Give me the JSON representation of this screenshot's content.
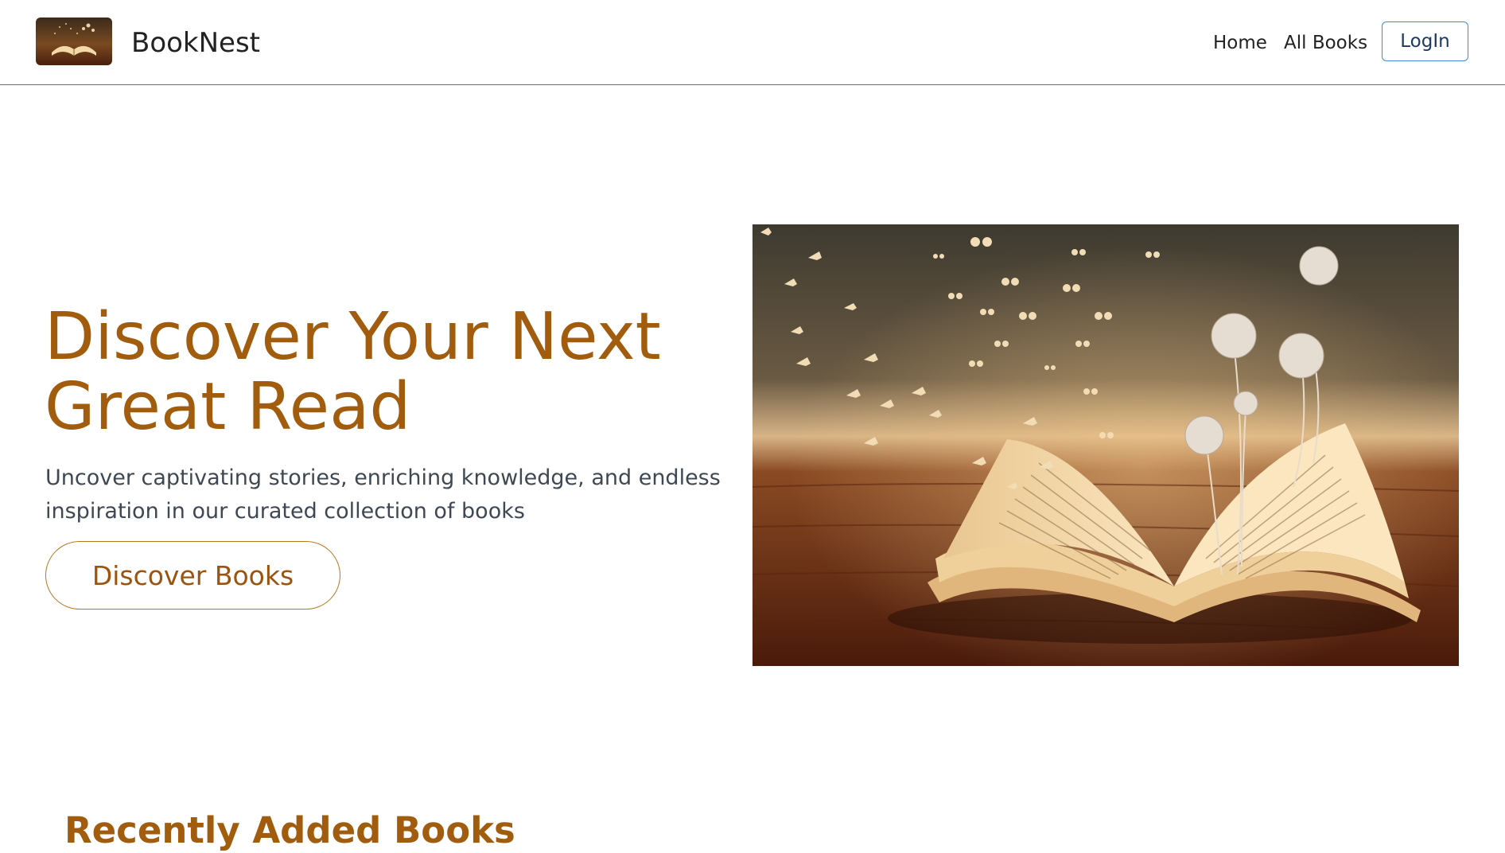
{
  "navbar": {
    "brand_name": "BookNest",
    "links": [
      {
        "label": "Home"
      },
      {
        "label": "All Books"
      }
    ],
    "login_label": "LogIn"
  },
  "hero": {
    "title": "Discover Your Next Great Read",
    "subtitle": "Uncover captivating stories, enriching knowledge, and endless inspiration in our curated collection of books",
    "cta_label": "Discover Books"
  },
  "recent": {
    "heading": "Recently Added Books"
  },
  "colors": {
    "accent": "#a25c0d",
    "login_border": "#3d8bd8",
    "subtitle": "#3f4852"
  }
}
